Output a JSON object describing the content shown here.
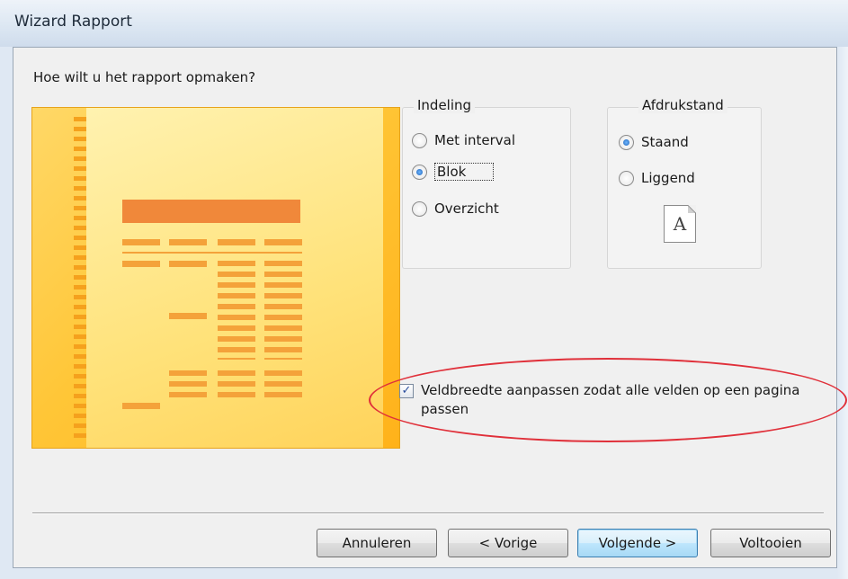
{
  "window": {
    "title": "Wizard Rapport"
  },
  "question": "Hoe wilt u het rapport opmaken?",
  "layout_group": {
    "legend": "Indeling",
    "options": [
      {
        "label": "Met interval",
        "selected": false
      },
      {
        "label": "Blok",
        "selected": true
      },
      {
        "label": "Overzicht",
        "selected": false
      }
    ]
  },
  "orientation_group": {
    "legend": "Afdrukstand",
    "options": [
      {
        "label": "Staand",
        "selected": true
      },
      {
        "label": "Liggend",
        "selected": false
      }
    ],
    "icon_letter": "A"
  },
  "fit_checkbox": {
    "label": "Veldbreedte aanpassen zodat alle velden op een pagina passen",
    "checked": true
  },
  "buttons": {
    "cancel": "Annuleren",
    "back": "< Vorige",
    "next": "Volgende >",
    "finish": "Voltooien"
  }
}
